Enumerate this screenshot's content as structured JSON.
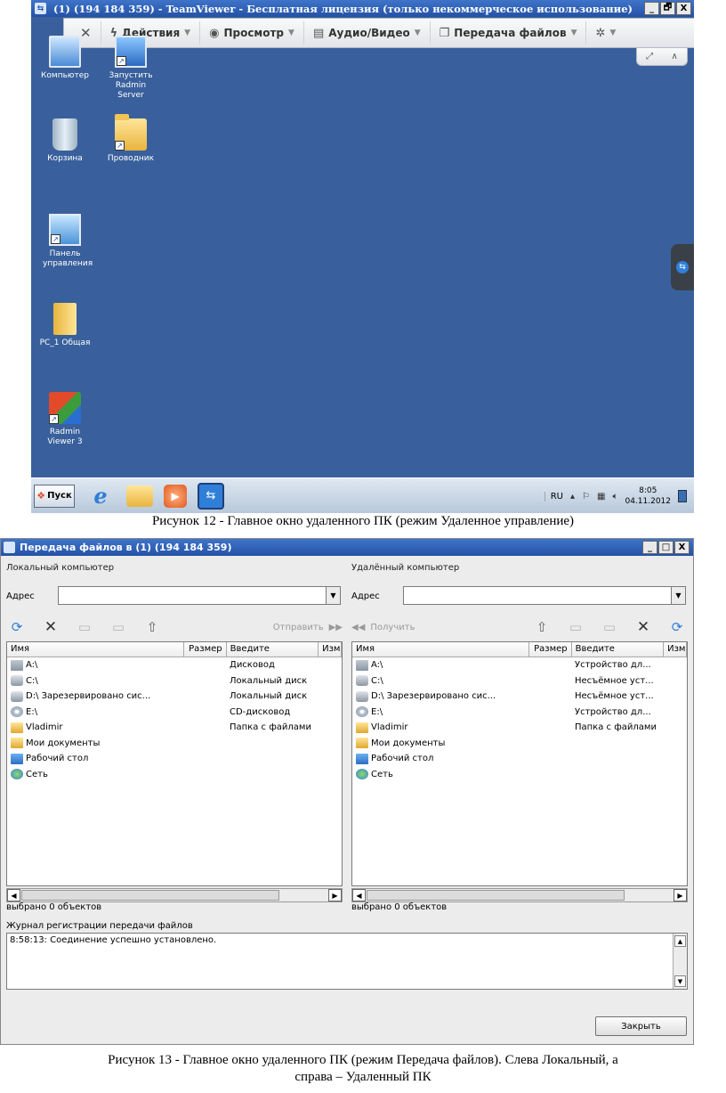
{
  "figure12": {
    "window_title": "(1) (194 184 359) - TeamViewer - Бесплатная лицензия (только некоммерческое использование)",
    "window_controls": [
      "_",
      "🗗",
      "X"
    ],
    "toolbar": {
      "close_label": "✕",
      "actions": "Действия",
      "view": "Просмотр",
      "audio_video": "Аудио/Видео",
      "file_transfer": "Передача файлов",
      "extras_icon": "gear-icon"
    },
    "subbar": {
      "fullscreen": "⤢",
      "collapse": "∧"
    },
    "desktop_icons": [
      {
        "label": "Компьютер",
        "icon": "computer-icon"
      },
      {
        "label": "Запустить Radmin Server",
        "icon": "radmin-server-icon"
      },
      {
        "label": "Корзина",
        "icon": "recycle-bin-icon"
      },
      {
        "label": "Проводник",
        "icon": "explorer-icon"
      },
      {
        "label": "Панель управления",
        "icon": "control-panel-icon"
      },
      {
        "label": "PC_1 Общая",
        "icon": "shared-folder-icon"
      },
      {
        "label": "Radmin Viewer 3",
        "icon": "radmin-viewer-icon"
      }
    ],
    "taskbar": {
      "start": "Пуск",
      "lang": "RU",
      "time": "8:05",
      "date": "04.11.2012"
    },
    "caption": "Рисунок 12 - Главное окно удаленного ПК (режим Удаленное управление)"
  },
  "figure13": {
    "window_title": "Передача файлов в  (1) (194 184 359)",
    "window_controls": [
      "_",
      "□",
      "X"
    ],
    "local": {
      "pane_label": "Локальный компьютер",
      "address_label": "Адрес",
      "address_value": "",
      "action": "Отправить",
      "columns": [
        "Имя",
        "Размер",
        "Введите",
        "Изм"
      ],
      "rows": [
        {
          "icon": "floppy",
          "name": "A:\\",
          "type": "Дисковод"
        },
        {
          "icon": "hdd",
          "name": "C:\\",
          "type": "Локальный диск"
        },
        {
          "icon": "hdd",
          "name": "D:\\  Зарезервировано сис...",
          "type": "Локальный диск"
        },
        {
          "icon": "cd",
          "name": "E:\\",
          "type": "CD-дисковод"
        },
        {
          "icon": "folder",
          "name": "Vladimir",
          "type": "Папка с файлами"
        },
        {
          "icon": "folder",
          "name": "Мои документы",
          "type": ""
        },
        {
          "icon": "desk",
          "name": "Рабочий стол",
          "type": ""
        },
        {
          "icon": "net",
          "name": "Сеть",
          "type": ""
        }
      ],
      "selected": "выбрано 0 объектов"
    },
    "remote": {
      "pane_label": "Удалённый компьютер",
      "address_label": "Адрес",
      "address_value": "",
      "action": "Получить",
      "columns": [
        "Имя",
        "Размер",
        "Введите",
        "Изм"
      ],
      "rows": [
        {
          "icon": "floppy",
          "name": "A:\\",
          "type": "Устройство дл..."
        },
        {
          "icon": "hdd",
          "name": "C:\\",
          "type": "Несъёмное уст..."
        },
        {
          "icon": "hdd",
          "name": "D:\\  Зарезервировано сис...",
          "type": "Несъёмное уст..."
        },
        {
          "icon": "cd",
          "name": "E:\\",
          "type": "Устройство дл..."
        },
        {
          "icon": "folder",
          "name": "Vladimir",
          "type": "Папка с файлами"
        },
        {
          "icon": "folder",
          "name": "Мои документы",
          "type": ""
        },
        {
          "icon": "desk",
          "name": "Рабочий стол",
          "type": ""
        },
        {
          "icon": "net",
          "name": "Сеть",
          "type": ""
        }
      ],
      "selected": "выбрано 0 объектов"
    },
    "log_label": "Журнал регистрации передачи файлов",
    "log_text": "8:58:13: Соединение успешно установлено.",
    "close_button": "Закрыть",
    "caption_line1": "Рисунок 13 - Главное окно удаленного ПК (режим Передача файлов). Слева Локальный, а",
    "caption_line2": "справа – Удаленный ПК"
  }
}
